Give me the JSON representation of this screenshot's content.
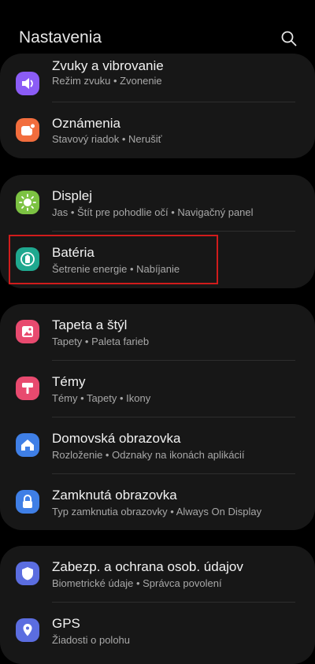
{
  "header": {
    "title": "Nastavenia"
  },
  "groups": [
    {
      "items": [
        {
          "label": "Zvuky a vibrovanie",
          "sub": "Režim zvuku  •  Zvonenie",
          "icon": "volume-icon",
          "color": "#8b5cf6"
        },
        {
          "label": "Oznámenia",
          "sub": "Stavový riadok  •  Nerušiť",
          "icon": "notification-icon",
          "color": "#f26d3d"
        }
      ]
    },
    {
      "items": [
        {
          "label": "Displej",
          "sub": "Jas  •  Štít pre pohodlie očí  •  Navigačný panel",
          "icon": "sun-icon",
          "color": "#7cc242"
        },
        {
          "label": "Batéria",
          "sub": "Šetrenie energie  •  Nabíjanie",
          "icon": "battery-icon",
          "color": "#1fa88f"
        }
      ]
    },
    {
      "items": [
        {
          "label": "Tapeta a štýl",
          "sub": "Tapety  •  Paleta farieb",
          "icon": "wallpaper-icon",
          "color": "#e84a6f"
        },
        {
          "label": "Témy",
          "sub": "Témy  •  Tapety  •  Ikony",
          "icon": "themes-icon",
          "color": "#e84a6f"
        },
        {
          "label": "Domovská obrazovka",
          "sub": "Rozloženie  •  Odznaky na ikonách aplikácií",
          "icon": "home-icon",
          "color": "#3f7fe6"
        },
        {
          "label": "Zamknutá obrazovka",
          "sub": "Typ zamknutia obrazovky  •  Always On Display",
          "icon": "lock-icon",
          "color": "#3f7fe6"
        }
      ]
    },
    {
      "items": [
        {
          "label": "Zabezp. a ochrana osob. údajov",
          "sub": "Biometrické údaje  •  Správca povolení",
          "icon": "shield-icon",
          "color": "#5b6de0"
        },
        {
          "label": "GPS",
          "sub": "Žiadosti o polohu",
          "icon": "location-icon",
          "color": "#5b6de0"
        }
      ]
    }
  ]
}
